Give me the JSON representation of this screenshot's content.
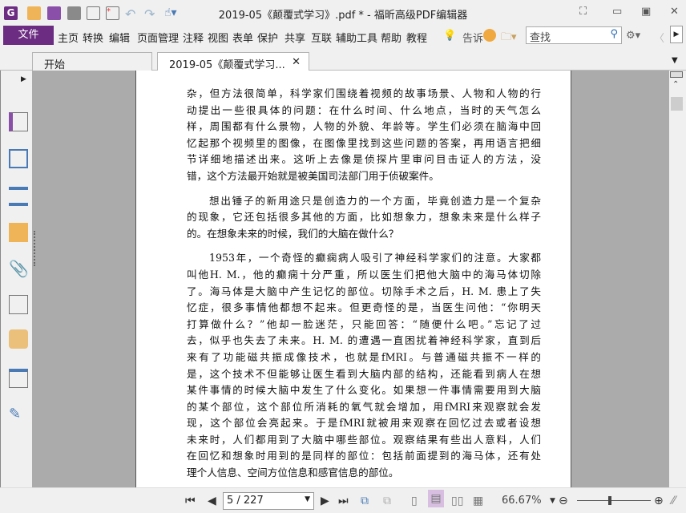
{
  "window": {
    "title": "2019-05《颠覆式学习》.pdf * - 福昕高级PDF编辑器"
  },
  "menu": {
    "file": "文件",
    "items": [
      "主页",
      "转换",
      "编辑",
      "页面管理",
      "注释",
      "视图",
      "表单",
      "保护",
      "共享",
      "互联",
      "辅助工具",
      "帮助",
      "教程"
    ],
    "tell": "告诉",
    "search_placeholder": "查找"
  },
  "tabs": [
    {
      "label": "开始"
    },
    {
      "label": "2019-05《颠覆式学习..."
    }
  ],
  "document": {
    "paragraphs": [
      {
        "indent": false,
        "lines": [
          "杂，但方法很简单，科学家们围绕着视频的故事场景、人物和人物的行",
          "动提出一些很具体的问题：在什么时间、什么地点，当时的天气怎么",
          "样，周围都有什么景物，人物的外貌、年龄等。学生们必须在脑海中回",
          "忆起那个视频里的图像，在图像里找到这些问题的答案，再用语言把细",
          "节详细地描述出来。这听上去像是侦探片里审问目击证人的方法，没",
          "错，这个方法最开始就是被美国司法部门用于侦破案件。"
        ]
      },
      {
        "indent": true,
        "lines": [
          "想出锤子的新用途只是创造力的一个方面，毕竟创造力是一个复杂",
          "的现象，它还包括很多其他的方面，比如想象力，想象未来是什么样子",
          "的。在想象未来的时候，我们的大脑在做什么？"
        ]
      },
      {
        "indent": true,
        "lines": [
          "1953年，一个奇怪的癫痫病人吸引了神经科学家们的注意。大家都",
          "叫他H. M.，他的癫痫十分严重，所以医生们把他大脑中的海马体切除",
          "了。海马体是大脑中产生记忆的部位。切除手术之后，H. M. 患上了失",
          "忆症，很多事情他都想不起来。但更奇怪的是，当医生问他：“你明天",
          "打算做什么？”他却一脸迷茫，只能回答：“随便什么吧。”忘记了过",
          "去，似乎也失去了未来。H. M. 的遭遇一直困扰着神经科学家，直到后",
          "来有了功能磁共振成像技术，也就是fMRI。与普通磁共振不一样的",
          "是，这个技术不但能够让医生看到大脑内部的结构，还能看到病人在想",
          "某件事情的时候大脑中发生了什么变化。如果想一件事情需要用到大脑",
          "的某个部位，这个部位所消耗的氧气就会增加，用fMRI来观察就会发",
          "现，这个部位会亮起来。于是fMRI就被用来观察在回忆过去或者设想",
          "未来时，人们都用到了大脑中哪些部位。观察结果有些出人意料，人们",
          "在回忆和想象时用到的是同样的部位：包括前面提到的海马体，还有处",
          "理个人信息、空间方位信息和感官信息的部位。"
        ]
      }
    ]
  },
  "status": {
    "page": "5 / 227",
    "zoom": "66.67%",
    "zoom_slider_fraction": 0.45
  },
  "colors": {
    "accent": "#6b2c82",
    "viewer_bg": "#ababab"
  }
}
